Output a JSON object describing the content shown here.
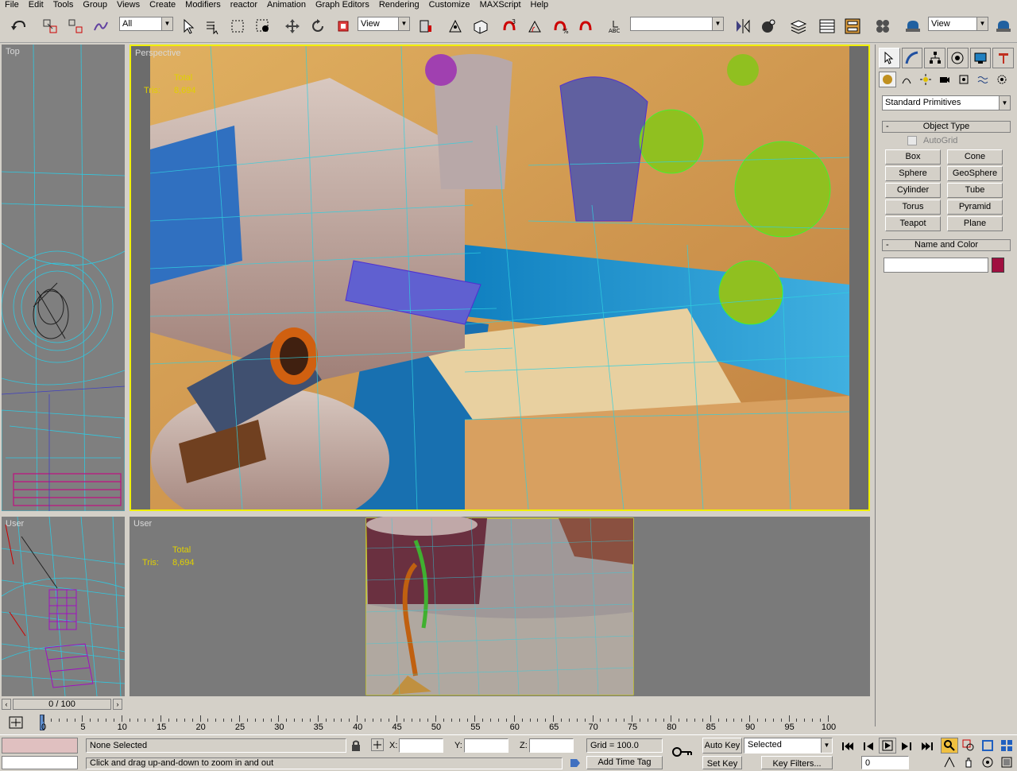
{
  "menu": [
    "File",
    "Edit",
    "Tools",
    "Group",
    "Views",
    "Create",
    "Modifiers",
    "reactor",
    "Animation",
    "Graph Editors",
    "Rendering",
    "Customize",
    "MAXScript",
    "Help"
  ],
  "toolbar": {
    "selection_filter": "All",
    "ref_coord": "View",
    "named_selection": "",
    "ref_coord_right": "View"
  },
  "viewports": {
    "top": {
      "label": "Top"
    },
    "perspective": {
      "label": "Perspective",
      "stats_total": "Total",
      "stats_tris_label": "Tris:",
      "stats_tris_value": "8,694"
    },
    "user_left": {
      "label": "User"
    },
    "user_main": {
      "label": "User",
      "stats_total": "Total",
      "stats_tris_label": "Tris:",
      "stats_tris_value": "8,694"
    }
  },
  "command_panel": {
    "category": "Standard Primitives",
    "object_type_title": "Object Type",
    "autogrid": "AutoGrid",
    "primitives": [
      "Box",
      "Cone",
      "Sphere",
      "GeoSphere",
      "Cylinder",
      "Tube",
      "Torus",
      "Pyramid",
      "Teapot",
      "Plane"
    ],
    "name_color_title": "Name and Color",
    "name_value": "",
    "color": "#a01040"
  },
  "timeline": {
    "slider_label": "0 / 100",
    "ticks": [
      "0",
      "5",
      "10",
      "15",
      "20",
      "25",
      "30",
      "35",
      "40",
      "45",
      "50",
      "55",
      "60",
      "65",
      "70",
      "75",
      "80",
      "85",
      "90",
      "95",
      "100"
    ]
  },
  "status": {
    "selection": "None Selected",
    "prompt": "Click and drag up-and-down to zoom in and out",
    "x_label": "X:",
    "y_label": "Y:",
    "z_label": "Z:",
    "x_value": "",
    "y_value": "",
    "z_value": "",
    "grid": "Grid = 100.0",
    "add_time_tag": "Add Time Tag",
    "auto_key": "Auto Key",
    "set_key": "Set Key",
    "key_mode": "Selected",
    "key_filters": "Key Filters...",
    "frame": "0"
  }
}
